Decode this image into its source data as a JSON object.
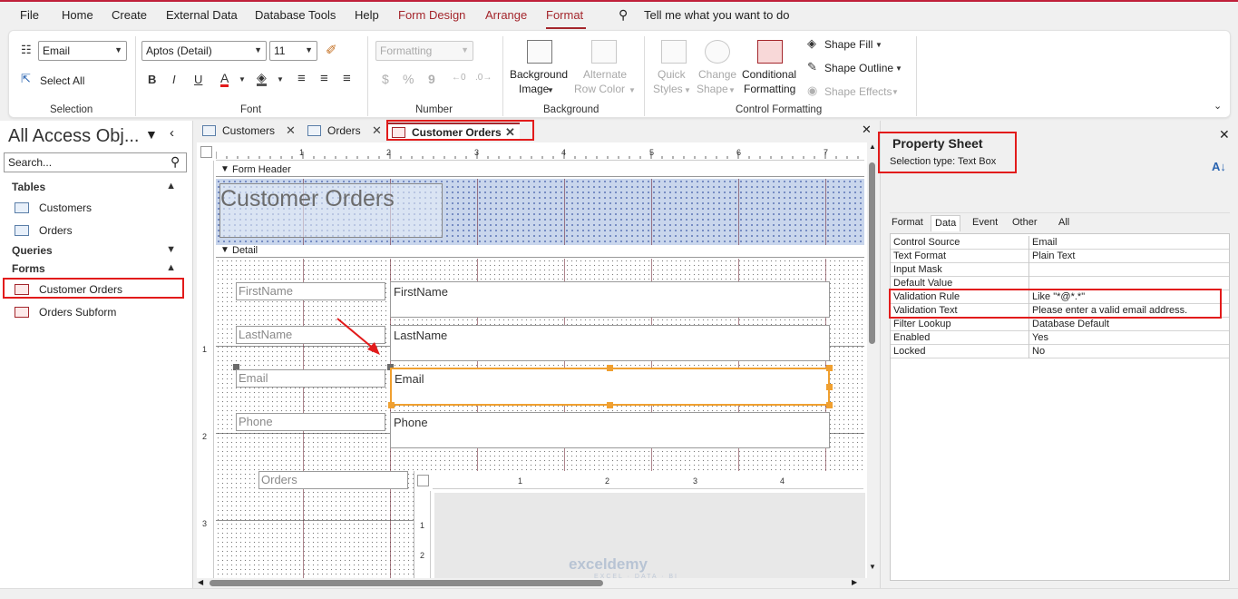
{
  "menu": {
    "file": "File",
    "home": "Home",
    "create": "Create",
    "external_data": "External Data",
    "database_tools": "Database Tools",
    "help": "Help",
    "form_design": "Form Design",
    "arrange": "Arrange",
    "format": "Format",
    "tell_me": "Tell me what you want to do"
  },
  "ribbon": {
    "selection": {
      "object_combo": "Email",
      "select_all": "Select All",
      "label": "Selection"
    },
    "font": {
      "font_name": "Aptos (Detail)",
      "font_size": "11",
      "bold": "B",
      "italic": "I",
      "underline": "U",
      "font_color": "A",
      "label": "Font"
    },
    "number": {
      "format_combo": "Formatting",
      "currency": "$",
      "percent": "%",
      "comma": "9",
      "label": "Number"
    },
    "background": {
      "background_image": "Background",
      "background_image_2": "Image",
      "alternate_row": "Alternate",
      "alternate_row_2": "Row Color",
      "label": "Background"
    },
    "control_formatting": {
      "quick_styles": "Quick",
      "quick_styles_2": "Styles",
      "change_shape": "Change",
      "change_shape_2": "Shape",
      "conditional": "Conditional",
      "conditional_2": "Formatting",
      "shape_fill": "Shape Fill",
      "shape_outline": "Shape Outline",
      "shape_effects": "Shape Effects",
      "label": "Control Formatting"
    }
  },
  "nav": {
    "title": "All Access Obj...",
    "search_placeholder": "Search...",
    "sections": [
      {
        "name": "Tables",
        "items": [
          "Customers",
          "Orders"
        ]
      },
      {
        "name": "Queries",
        "items": []
      },
      {
        "name": "Forms",
        "items": [
          "Customer Orders",
          "Orders Subform"
        ]
      }
    ]
  },
  "doc_tabs": [
    {
      "label": "Customers"
    },
    {
      "label": "Orders"
    },
    {
      "label": "Customer Orders"
    }
  ],
  "design": {
    "form_header_label": "Form Header",
    "detail_label": "Detail",
    "form_title": "Customer Orders",
    "ruler_numbers": [
      "1",
      "2",
      "3",
      "4",
      "5",
      "6",
      "7"
    ],
    "vruler_numbers": [
      "1",
      "2",
      "3"
    ],
    "sub_ruler_numbers": [
      "1",
      "2",
      "3",
      "4"
    ],
    "sub_vruler_numbers": [
      "1",
      "2"
    ],
    "fields": [
      {
        "label": "FirstName",
        "box": "FirstName"
      },
      {
        "label": "LastName",
        "box": "LastName"
      },
      {
        "label": "Email",
        "box": "Email"
      },
      {
        "label": "Phone",
        "box": "Phone"
      }
    ],
    "subform_label": "Orders"
  },
  "property_sheet": {
    "title": "Property Sheet",
    "selection_type": "Selection type:  Text Box",
    "tabs": [
      "Format",
      "Data",
      "Event",
      "Other",
      "All"
    ],
    "active_tab": "Data",
    "rows": [
      {
        "name": "Control Source",
        "value": "Email"
      },
      {
        "name": "Text Format",
        "value": "Plain Text"
      },
      {
        "name": "Input Mask",
        "value": ""
      },
      {
        "name": "Default Value",
        "value": ""
      },
      {
        "name": "Validation Rule",
        "value": "Like \"*@*.*\""
      },
      {
        "name": "Validation Text",
        "value": "Please enter a valid email address."
      },
      {
        "name": "Filter Lookup",
        "value": "Database Default"
      },
      {
        "name": "Enabled",
        "value": "Yes"
      },
      {
        "name": "Locked",
        "value": "No"
      }
    ]
  },
  "watermark": {
    "brand": "exceldemy",
    "tagline": "EXCEL · DATA · BI"
  },
  "colors": {
    "accent": "#a4262c",
    "highlight": "#e21b1b",
    "selection": "#f0a030",
    "header_fill": "#c9d6ec"
  }
}
